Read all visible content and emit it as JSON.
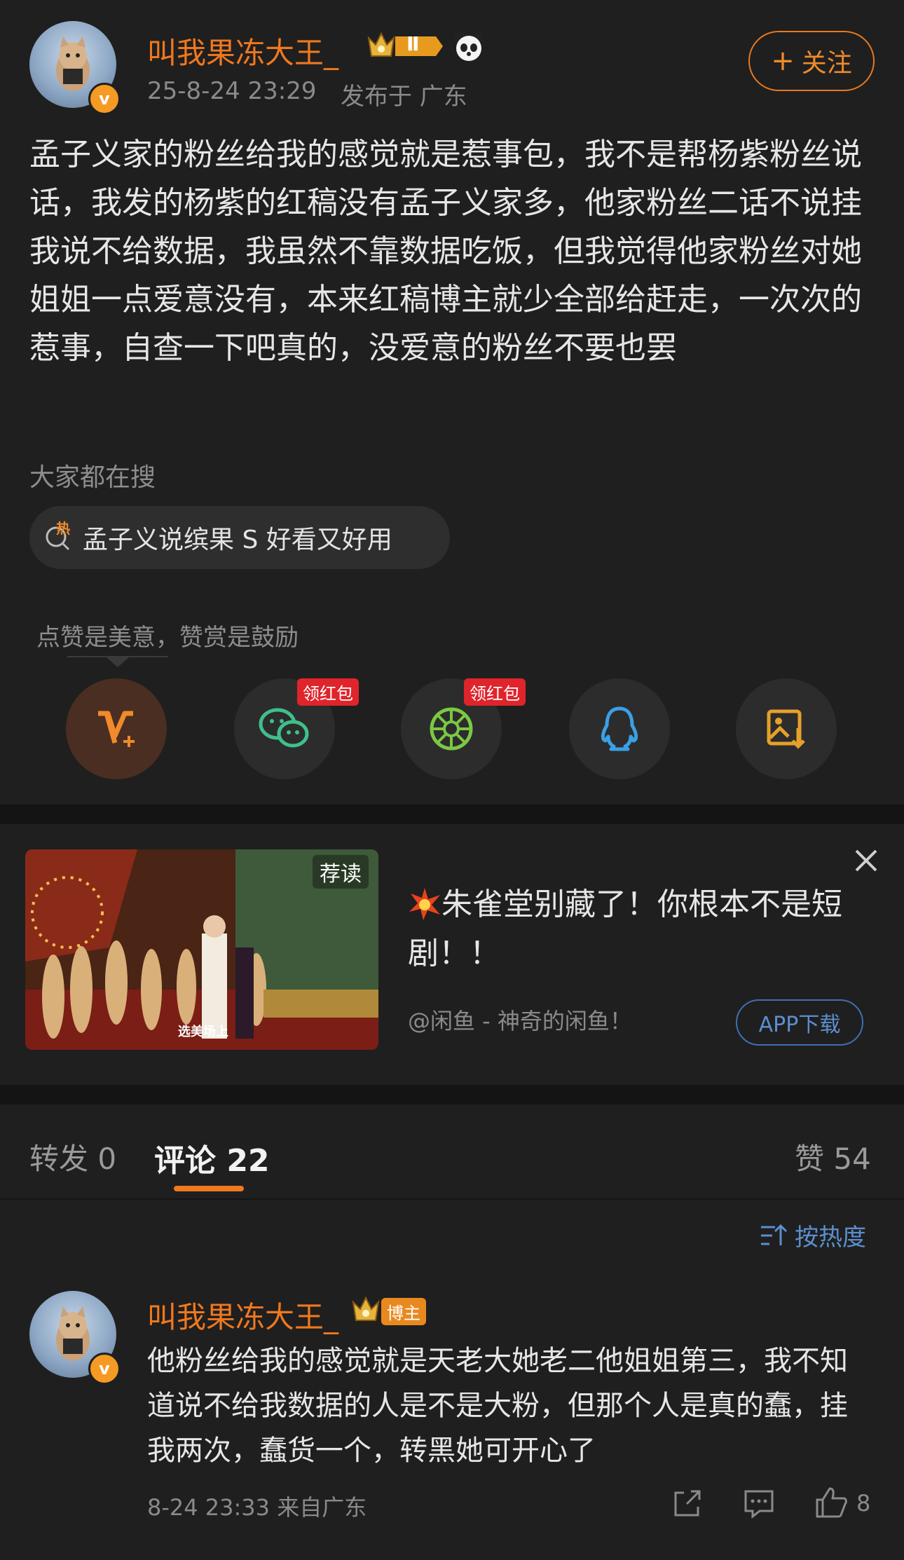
{
  "post": {
    "author": "叫我果冻大王_",
    "time": "25-8-24 23:29",
    "location": "发布于 广东",
    "follow_label": "关注",
    "body": "孟子义家的粉丝给我的感觉就是惹事包，我不是帮杨紫粉丝说话，我发的杨紫的红稿没有孟子义家多，他家粉丝二话不说挂我说不给数据，我虽然不靠数据吃饭，但我觉得他家粉丝对她姐姐一点爱意没有，本来红稿博主就少全部给赶走，一次次的惹事，自查一下吧真的，没爱意的粉丝不要也罢",
    "badge_level": "Ⅱ"
  },
  "search": {
    "label": "大家都在搜",
    "hot_tag": "热",
    "query": "孟子义说缤果 S 好看又好用"
  },
  "share": {
    "caption": "点赞是美意，赞赏是鼓励",
    "red_packet_label": "领红包"
  },
  "ad": {
    "tag": "荐读",
    "video_caption": "选美场上",
    "title": "朱雀堂别藏了！你根本不是短剧！！",
    "source": "@闲鱼 - 神奇的闲鱼！",
    "button": "APP下载"
  },
  "tabs": {
    "repost": "转发 0",
    "comment": "评论 22",
    "like": "赞 54"
  },
  "sort_label": "按热度",
  "comment": {
    "author": "叫我果冻大王_",
    "role_badge": "博主",
    "text": "他粉丝给我的感觉就是天老大她老二他姐姐第三，我不知道说不给我数据的人是不是大粉，但那个人是真的蠢，挂我两次，蠢货一个，转黑她可开心了",
    "time": "8-24 23:33 来自广东",
    "like_count": "8"
  },
  "colors": {
    "background": "#1f1f1f",
    "accent_orange": "#f0781e",
    "link_blue": "#5b8fcf"
  }
}
